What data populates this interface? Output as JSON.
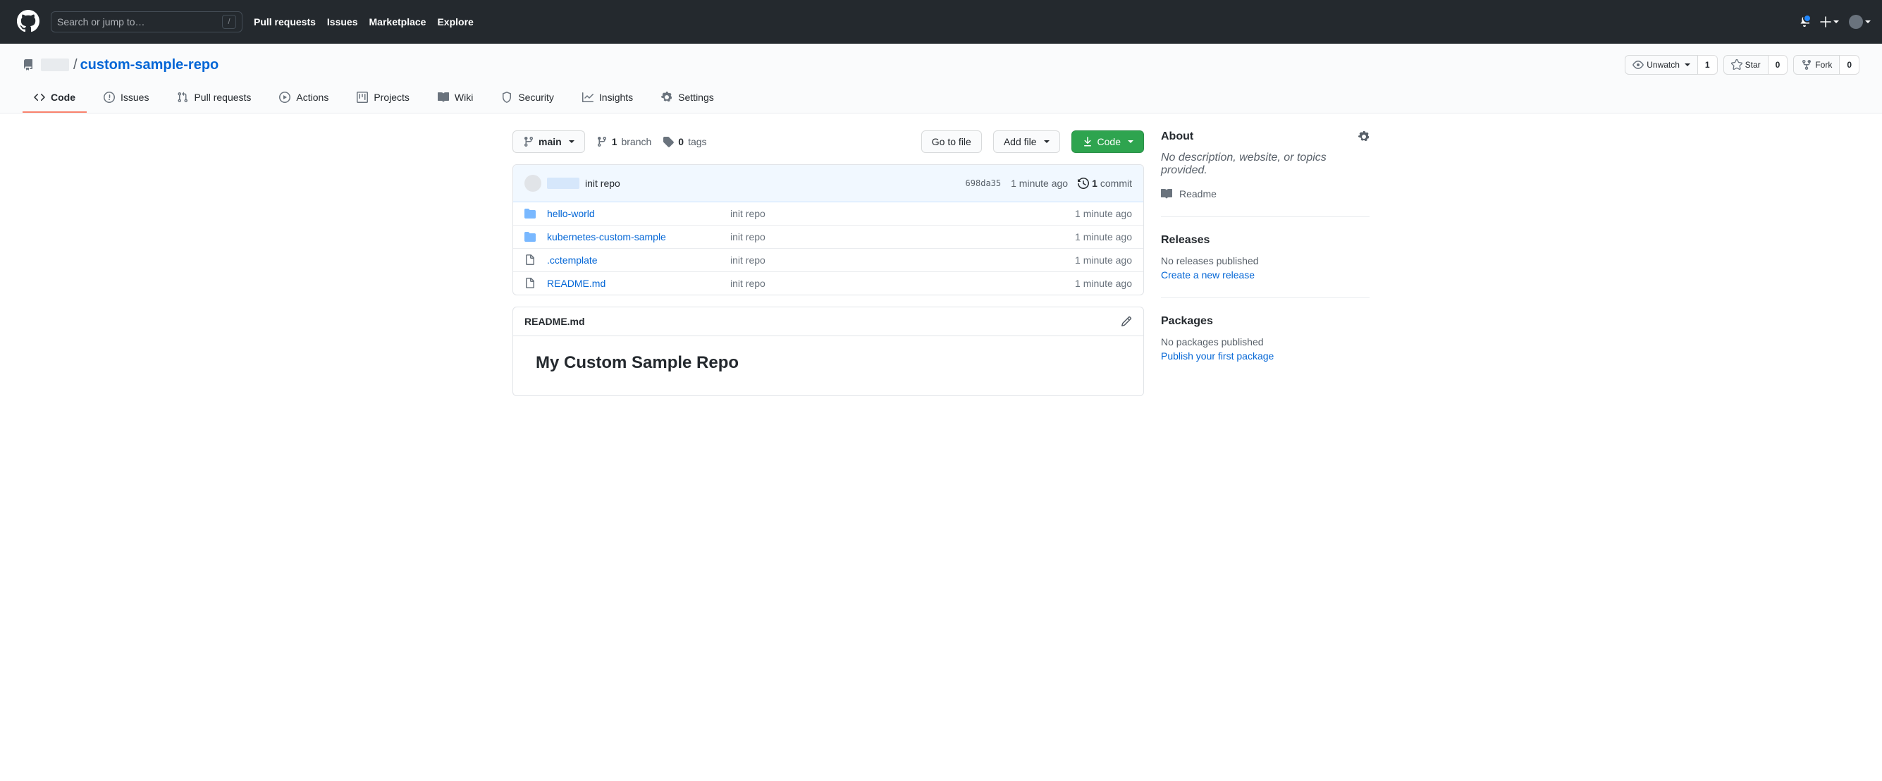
{
  "header": {
    "search_placeholder": "Search or jump to…",
    "slash": "/",
    "nav": [
      "Pull requests",
      "Issues",
      "Marketplace",
      "Explore"
    ]
  },
  "repo": {
    "owner_hidden": true,
    "separator": "/",
    "name": "custom-sample-repo",
    "actions": {
      "unwatch": {
        "label": "Unwatch",
        "count": "1"
      },
      "star": {
        "label": "Star",
        "count": "0"
      },
      "fork": {
        "label": "Fork",
        "count": "0"
      }
    },
    "tabs": [
      {
        "key": "code",
        "label": "Code",
        "active": true
      },
      {
        "key": "issues",
        "label": "Issues"
      },
      {
        "key": "pulls",
        "label": "Pull requests"
      },
      {
        "key": "actions",
        "label": "Actions"
      },
      {
        "key": "projects",
        "label": "Projects"
      },
      {
        "key": "wiki",
        "label": "Wiki"
      },
      {
        "key": "security",
        "label": "Security"
      },
      {
        "key": "insights",
        "label": "Insights"
      },
      {
        "key": "settings",
        "label": "Settings"
      }
    ]
  },
  "file_nav": {
    "branch": "main",
    "branches": {
      "count": "1",
      "label": "branch"
    },
    "tags": {
      "count": "0",
      "label": "tags"
    },
    "go_to_file": "Go to file",
    "add_file": "Add file",
    "code": "Code"
  },
  "latest_commit": {
    "message": "init repo",
    "hash": "698da35",
    "time": "1 minute ago",
    "commits_count": "1",
    "commits_label": "commit"
  },
  "files": [
    {
      "type": "dir",
      "name": "hello-world",
      "commit": "init repo",
      "time": "1 minute ago"
    },
    {
      "type": "dir",
      "name": "kubernetes-custom-sample",
      "commit": "init repo",
      "time": "1 minute ago"
    },
    {
      "type": "file",
      "name": ".cctemplate",
      "commit": "init repo",
      "time": "1 minute ago"
    },
    {
      "type": "file",
      "name": "README.md",
      "commit": "init repo",
      "time": "1 minute ago"
    }
  ],
  "readme": {
    "filename": "README.md",
    "heading": "My Custom Sample Repo"
  },
  "sidebar": {
    "about": {
      "title": "About",
      "desc": "No description, website, or topics provided.",
      "readme": "Readme"
    },
    "releases": {
      "title": "Releases",
      "none": "No releases published",
      "action": "Create a new release"
    },
    "packages": {
      "title": "Packages",
      "none": "No packages published",
      "action": "Publish your first package"
    }
  }
}
